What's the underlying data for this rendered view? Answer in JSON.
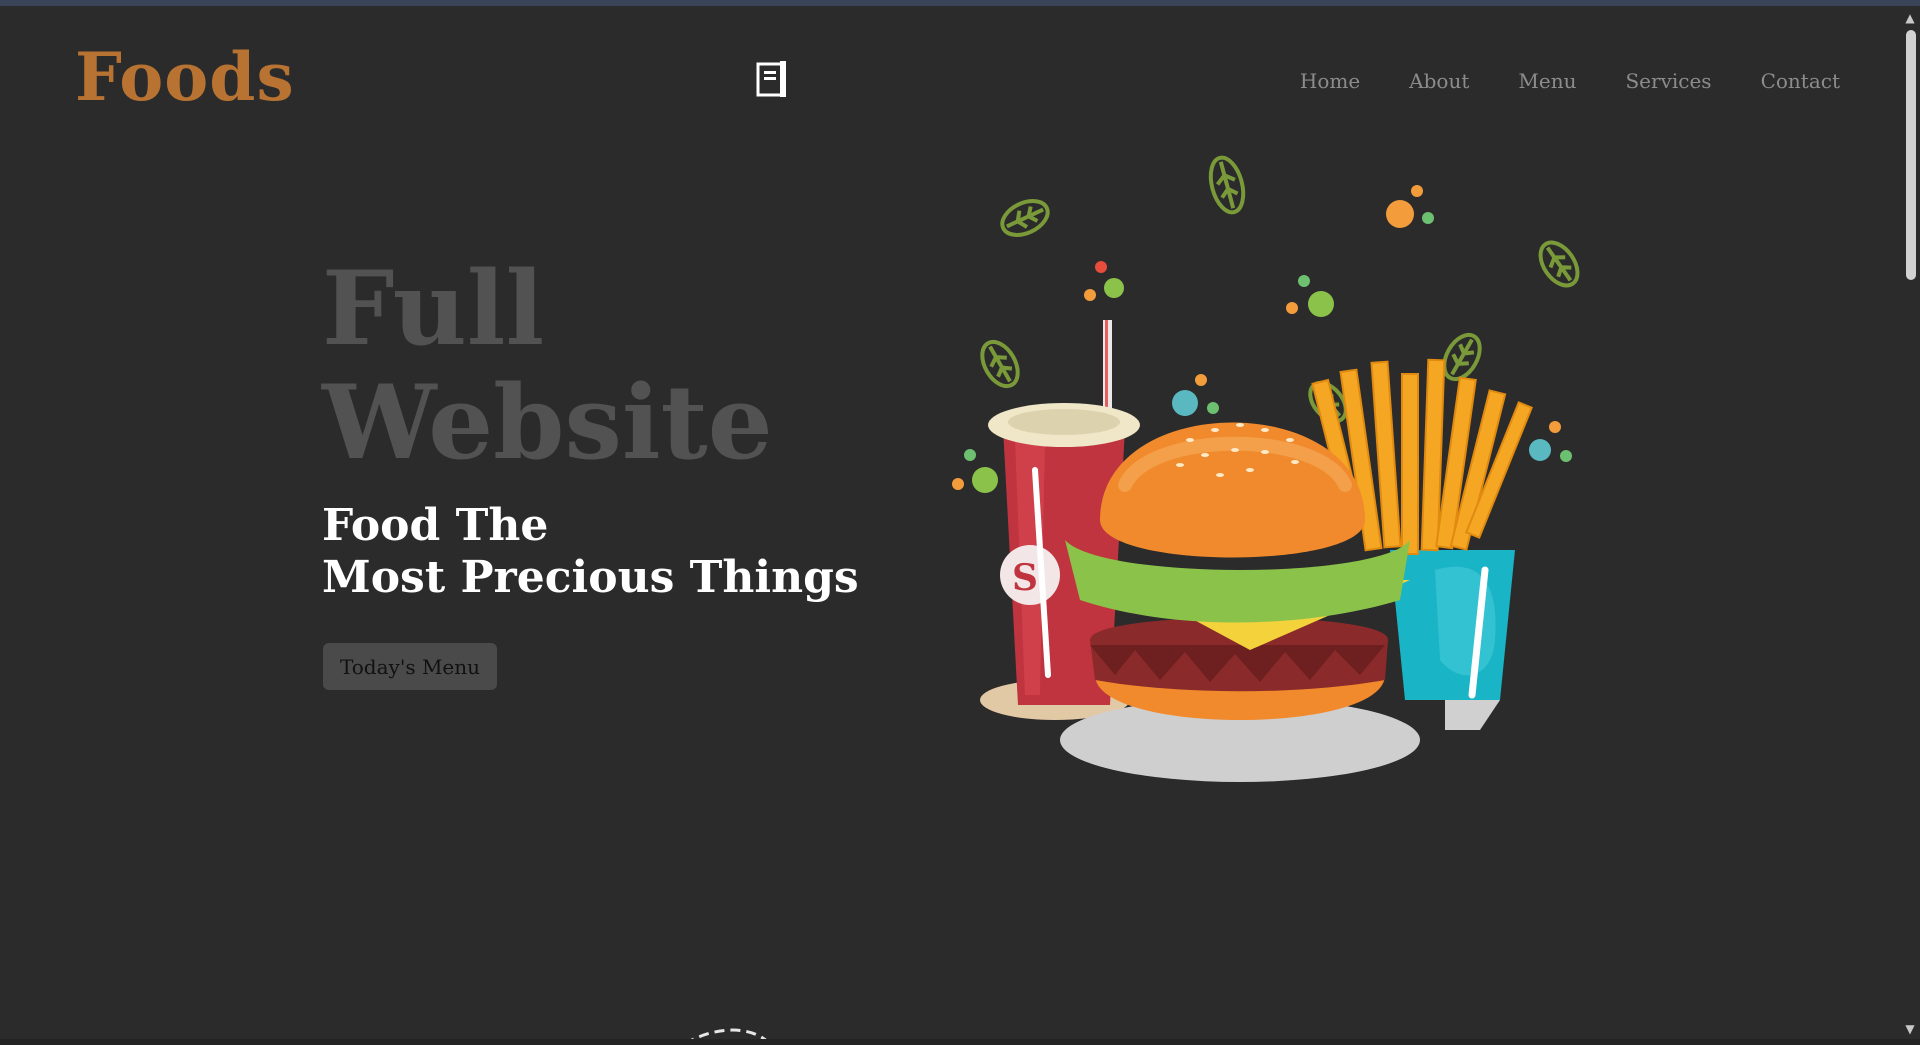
{
  "brand": {
    "logo_text": "Foods"
  },
  "nav": {
    "items": [
      {
        "label": "Home"
      },
      {
        "label": "About"
      },
      {
        "label": "Menu"
      },
      {
        "label": "Services"
      },
      {
        "label": "Contact"
      }
    ]
  },
  "hero": {
    "title_line1": "Full",
    "title_line2": "Website",
    "subtitle_line1": "Food The",
    "subtitle_line2": "Most Precious Things",
    "cta_label": "Today's Menu"
  },
  "colors": {
    "background": "#2b2b2b",
    "logo": "#b87333",
    "nav_text": "#8c8c8c",
    "hero_title": "#525252",
    "hero_subtitle": "#ffffff",
    "button_bg": "#4a4a4a"
  },
  "icons": {
    "header_center": "book-icon",
    "cup_logo_letter": "S"
  }
}
